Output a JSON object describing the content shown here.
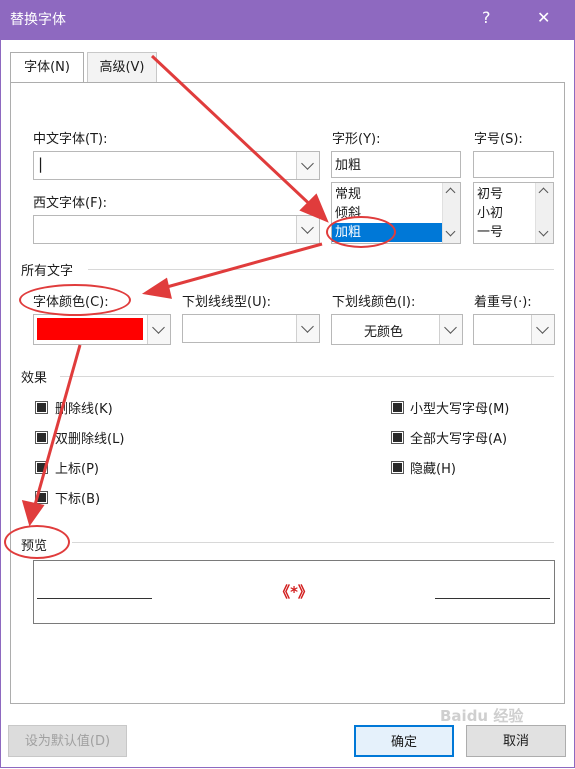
{
  "window": {
    "title": "替换字体",
    "help": "?",
    "close": "✕"
  },
  "tabs": [
    {
      "label": "字体(N)"
    },
    {
      "label": "高级(V)"
    }
  ],
  "font": {
    "chinese_font_label": "中文字体(T):",
    "chinese_font_value": "|",
    "western_font_label": "西文字体(F):",
    "style_label": "字形(Y):",
    "style_value": "加粗",
    "style_options": [
      "常规",
      "倾斜",
      "加粗"
    ],
    "size_label": "字号(S):",
    "size_options": [
      "初号",
      "小初",
      "一号"
    ]
  },
  "all_text": {
    "section_label": "所有文字",
    "font_color_label": "字体颜色(C):",
    "font_color_value": "#ff0000",
    "underline_type_label": "下划线线型(U):",
    "underline_color_label": "下划线颜色(I):",
    "underline_color_value": "无颜色",
    "emphasis_label": "着重号(·):"
  },
  "effects": {
    "section_label": "效果",
    "items": [
      {
        "label": "删除线(K)"
      },
      {
        "label": "双删除线(L)"
      },
      {
        "label": "上标(P)"
      },
      {
        "label": "下标(B)"
      },
      {
        "label": "小型大写字母(M)"
      },
      {
        "label": "全部大写字母(A)"
      },
      {
        "label": "隐藏(H)"
      }
    ]
  },
  "preview": {
    "section_label": "预览",
    "sample_text": "《*》",
    "sample_color": "#d21e1e"
  },
  "footer": {
    "default_button": "设为默认值(D)",
    "ok_button": "确定",
    "cancel_button": "取消"
  },
  "watermark": "Baidu 经验",
  "annotation_color": "#e03c3c"
}
